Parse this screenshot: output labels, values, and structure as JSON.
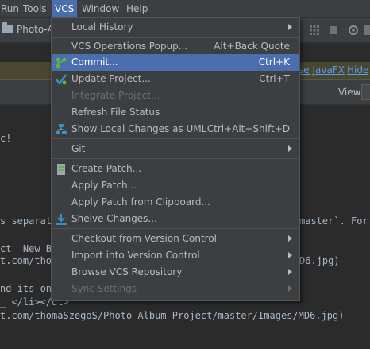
{
  "menubar": {
    "items": [
      {
        "label": "Run"
      },
      {
        "label": "Tools"
      },
      {
        "label": "VCS"
      },
      {
        "label": "Window"
      },
      {
        "label": "Help"
      }
    ]
  },
  "toolbar": {
    "breadcrumb": "Photo-A"
  },
  "notification": {
    "link1": "se JavaFX",
    "link2": "Hide"
  },
  "view": {
    "label": "View:"
  },
  "editor": {
    "lines": [
      "c!",
      "s separate",
      "ct _New Br",
      "t.com/thom",
      "nd its onl",
      "_ </li></ul>",
      "t.com/thomaSzegoS/Photo-Album-Project/master/Images/MD6.jpg)"
    ],
    "behind_fragments": [
      "master`. For e",
      "D6.jpg)"
    ]
  },
  "vcs_menu": {
    "items": [
      {
        "label": "Local History",
        "submenu": true
      },
      {
        "label": "VCS Operations Popup...",
        "shortcut": "Alt+Back Quote"
      },
      {
        "label": "Commit...",
        "shortcut": "Ctrl+K",
        "icon": "commit-icon",
        "selected": true
      },
      {
        "label": "Update Project...",
        "shortcut": "Ctrl+T",
        "icon": "update-project-icon"
      },
      {
        "label": "Integrate Project...",
        "disabled": true
      },
      {
        "label": "Refresh File Status"
      },
      {
        "label": "Show Local Changes as UML",
        "shortcut": "Ctrl+Alt+Shift+D",
        "icon": "uml-icon"
      },
      {
        "label": "Git",
        "submenu": true
      },
      {
        "label": "Create Patch...",
        "icon": "create-patch-icon"
      },
      {
        "label": "Apply Patch..."
      },
      {
        "label": "Apply Patch from Clipboard..."
      },
      {
        "label": "Shelve Changes...",
        "icon": "shelve-icon"
      },
      {
        "label": "Checkout from Version Control",
        "submenu": true
      },
      {
        "label": "Import into Version Control",
        "submenu": true
      },
      {
        "label": "Browse VCS Repository",
        "submenu": true
      },
      {
        "label": "Sync Settings",
        "submenu": true,
        "disabled": true
      }
    ]
  },
  "colors": {
    "accent": "#4b6eaf",
    "background": "#2b2b2b",
    "menu": "#3c3f41",
    "notification": "#49472f",
    "link": "#589df6"
  }
}
